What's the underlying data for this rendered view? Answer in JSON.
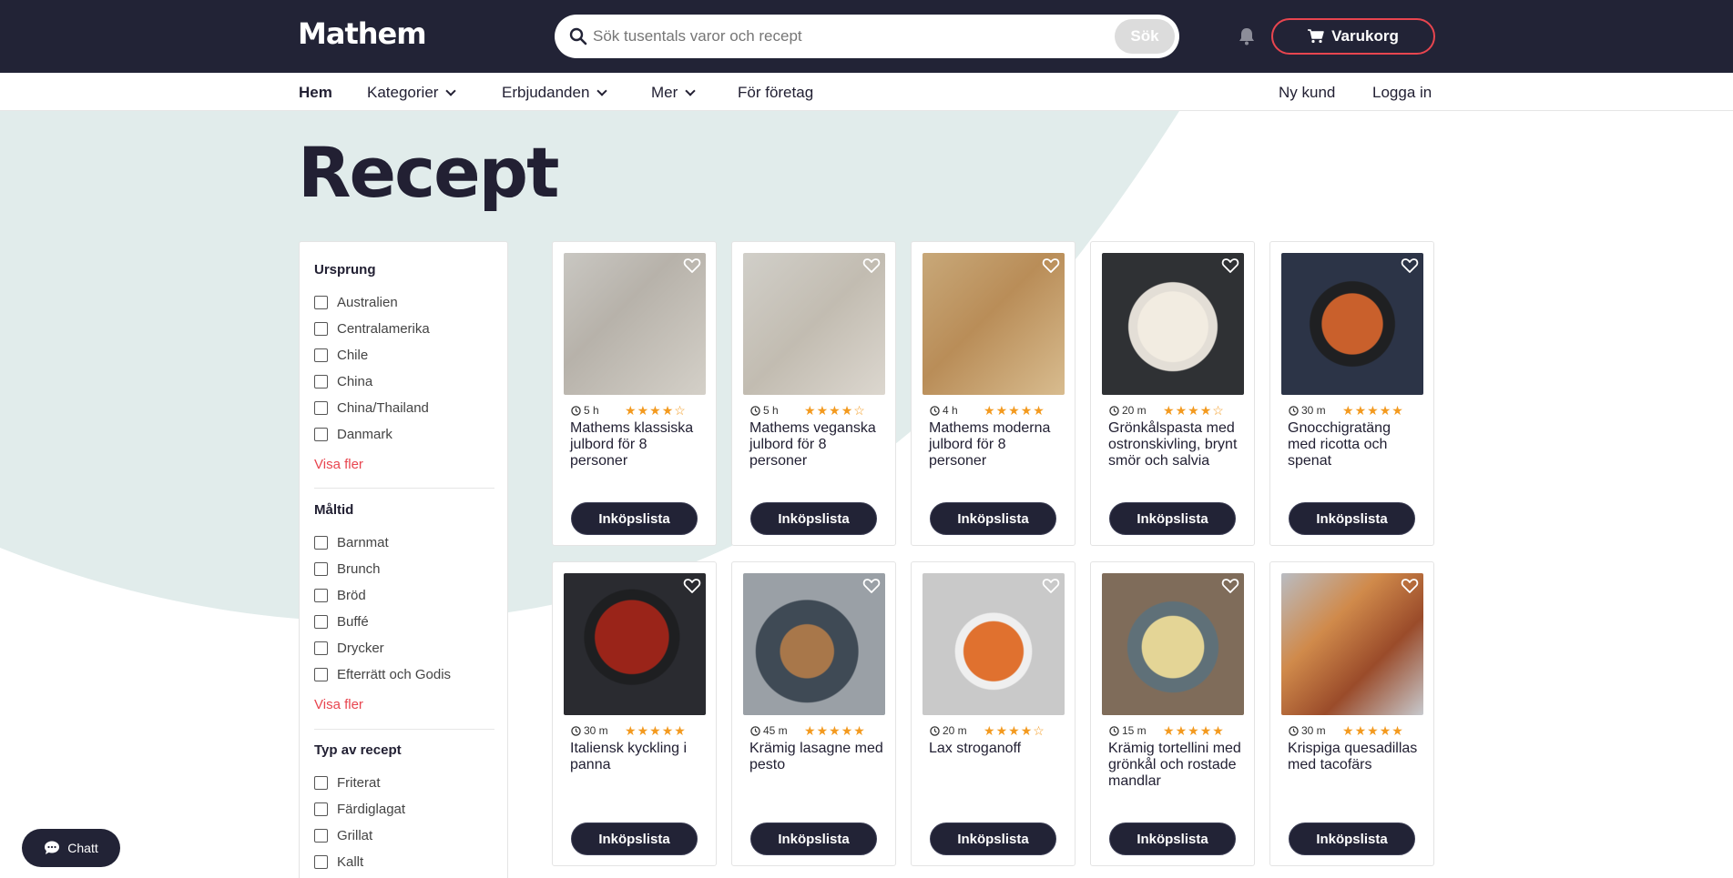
{
  "header": {
    "logo": "Mathem",
    "search_placeholder": "Sök tusentals varor och recept",
    "search_button": "Sök",
    "cart_label": "Varukorg",
    "icons": [
      "search-icon",
      "bell-icon",
      "cart-icon"
    ]
  },
  "nav": {
    "items": [
      {
        "label": "Hem",
        "active": true,
        "dropdown": false
      },
      {
        "label": "Kategorier",
        "active": false,
        "dropdown": true
      },
      {
        "label": "Erbjudanden",
        "active": false,
        "dropdown": true
      },
      {
        "label": "Mer",
        "active": false,
        "dropdown": true
      },
      {
        "label": "För företag",
        "active": false,
        "dropdown": false
      }
    ],
    "new_customer": "Ny kund",
    "login": "Logga in"
  },
  "page": {
    "title": "Recept"
  },
  "filters": [
    {
      "title": "Ursprung",
      "options": [
        "Australien",
        "Centralamerika",
        "Chile",
        "China",
        "China/Thailand",
        "Danmark"
      ],
      "more": "Visa fler"
    },
    {
      "title": "Måltid",
      "options": [
        "Barnmat",
        "Brunch",
        "Bröd",
        "Buffé",
        "Drycker",
        "Efterrätt och Godis"
      ],
      "more": "Visa fler"
    },
    {
      "title": "Typ av recept",
      "options": [
        "Friterat",
        "Färdiglagat",
        "Grillat",
        "Kallt"
      ],
      "more": ""
    }
  ],
  "recipes": [
    {
      "title": "Mathems klassiska julbord för 8 personer",
      "time": "5 h",
      "rating": 4,
      "button": "Inköpslista",
      "image": "julbord-classic"
    },
    {
      "title": "Mathems veganska julbord för 8 personer",
      "time": "5 h",
      "rating": 4,
      "button": "Inköpslista",
      "image": "julbord-vegan"
    },
    {
      "title": "Mathems moderna julbord för 8 personer",
      "time": "4 h",
      "rating": 5,
      "button": "Inköpslista",
      "image": "julbord-modern"
    },
    {
      "title": "Grönkålspasta med ostronskivling, brynt smör och salvia",
      "time": "20 m",
      "rating": 4,
      "button": "Inköpslista",
      "image": "pasta-plate"
    },
    {
      "title": "Gnocchigratäng med ricotta och spenat",
      "time": "30 m",
      "rating": 5,
      "button": "Inköpslista",
      "image": "gnocchi-pan"
    },
    {
      "title": "Italiensk kyckling i panna",
      "time": "30 m",
      "rating": 5,
      "button": "Inköpslista",
      "image": "chicken-pan"
    },
    {
      "title": "Krämig lasagne med pesto",
      "time": "45 m",
      "rating": 5,
      "button": "Inköpslista",
      "image": "lasagne"
    },
    {
      "title": "Lax stroganoff",
      "time": "20 m",
      "rating": 4,
      "button": "Inköpslista",
      "image": "stroganoff"
    },
    {
      "title": "Krämig tortellini med grönkål och rostade mandlar",
      "time": "15 m",
      "rating": 5,
      "button": "Inköpslista",
      "image": "tortellini"
    },
    {
      "title": "Krispiga quesadillas med tacofärs",
      "time": "30 m",
      "rating": 5,
      "button": "Inköpslista",
      "image": "quesadillas"
    }
  ],
  "chat": {
    "label": "Chatt"
  },
  "colors": {
    "header_bg": "#222336",
    "accent_red": "#e8454f",
    "star": "#f39a1f",
    "curve_bg": "#e1eceb"
  }
}
